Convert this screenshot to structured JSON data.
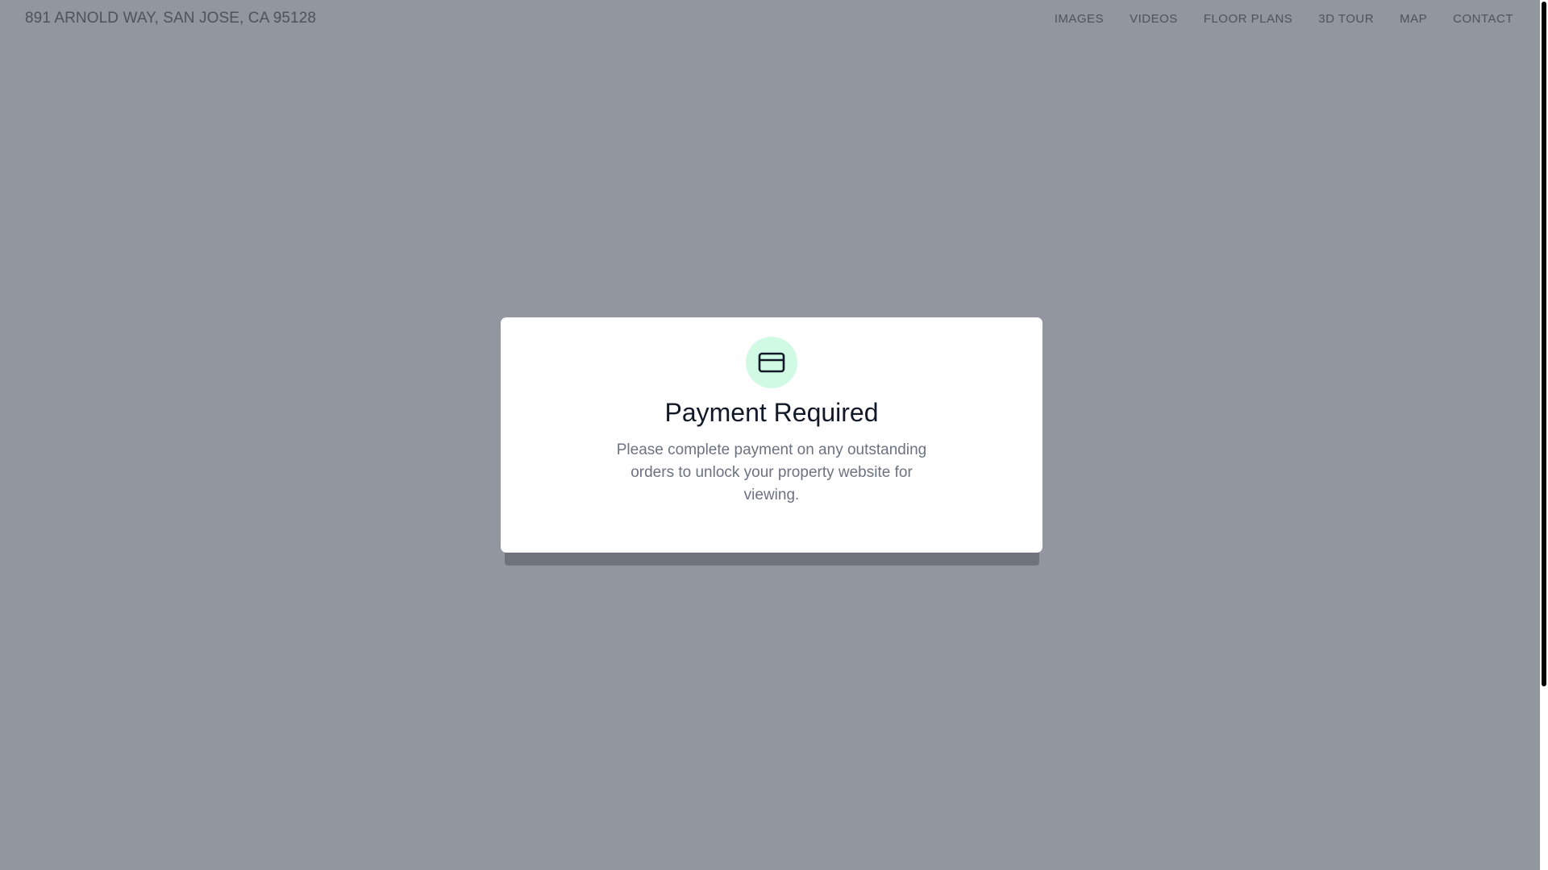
{
  "header": {
    "title": "891 ARNOLD WAY, SAN JOSE, CA 95128",
    "nav": [
      {
        "label": "IMAGES"
      },
      {
        "label": "VIDEOS"
      },
      {
        "label": "FLOOR PLANS"
      },
      {
        "label": "3D TOUR"
      },
      {
        "label": "MAP"
      },
      {
        "label": "CONTACT"
      }
    ]
  },
  "modal": {
    "icon": "credit-card-icon",
    "title": "Payment Required",
    "message": "Please complete payment on any outstanding orders to unlock your property website for viewing."
  },
  "colors": {
    "overlay": "#92969f",
    "icon_background": "#d1fae5",
    "title_text": "#111827",
    "body_text": "#6b7280",
    "nav_text": "#4e525b"
  }
}
